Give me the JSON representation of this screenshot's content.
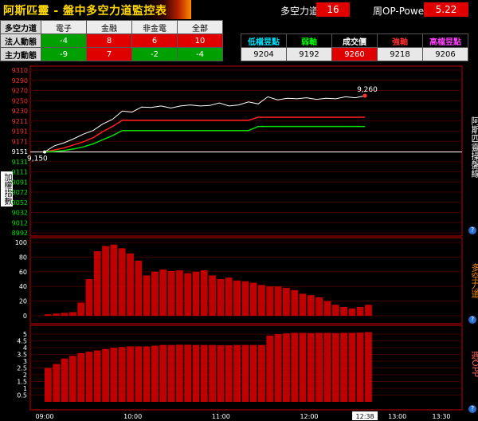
{
  "header": {
    "title": "阿斯匹靈 - 盤中多空力道監控表",
    "power_label": "多空力道",
    "power_value": "16",
    "op_label": "周OP-Power",
    "op_value": "5.22"
  },
  "table1": {
    "corner": "多空力道",
    "columns": [
      "電子",
      "金融",
      "非金電",
      "全部"
    ],
    "rows": [
      {
        "label": "法人動態",
        "cells": [
          {
            "v": "-4",
            "c": "g"
          },
          {
            "v": "8",
            "c": "r"
          },
          {
            "v": "6",
            "c": "r"
          },
          {
            "v": "10",
            "c": "r"
          }
        ]
      },
      {
        "label": "主力動態",
        "cells": [
          {
            "v": "-9",
            "c": "g"
          },
          {
            "v": "7",
            "c": "r"
          },
          {
            "v": "-2",
            "c": "g"
          },
          {
            "v": "-4",
            "c": "g"
          }
        ]
      }
    ]
  },
  "table2": {
    "headers": [
      {
        "label": "低檔昱點",
        "color": "#00e5ff"
      },
      {
        "label": "弱軸",
        "color": "#00ff00"
      },
      {
        "label": "成交價",
        "color": "#ffffff"
      },
      {
        "label": "強軸",
        "color": "#ff3030"
      },
      {
        "label": "高檔昱點",
        "color": "#ff40ff"
      }
    ],
    "values": [
      "9204",
      "9192",
      "9260",
      "9218",
      "9206"
    ],
    "highlight_index": 2
  },
  "side_labels": {
    "left_price": "加權指數",
    "right_top": "阿斯匹靈操盤線",
    "right_mid": "多空力道",
    "right_bot": "週OPP"
  },
  "chart_data": [
    {
      "type": "line",
      "title": "",
      "yticks": [
        "9310",
        "9290",
        "9270",
        "9250",
        "9230",
        "9211",
        "9191",
        "9171",
        "9151",
        "9131",
        "9111",
        "9091",
        "9072",
        "9052",
        "9032",
        "9012",
        "8992"
      ],
      "ylim": [
        8992,
        9310
      ],
      "open_label": "9,150",
      "last_label": "9,260",
      "series": [
        {
          "name": "成交價",
          "color": "#ffffff",
          "values": [
            9150,
            9162,
            9168,
            9176,
            9185,
            9192,
            9205,
            9214,
            9230,
            9228,
            9238,
            9237,
            9240,
            9236,
            9240,
            9242,
            9240,
            9241,
            9246,
            9240,
            9242,
            9248,
            9244,
            9258,
            9252,
            9255,
            9254,
            9256,
            9253,
            9255,
            9254,
            9258,
            9256,
            9260
          ]
        },
        {
          "name": "強軸",
          "color": "#ff2020",
          "values": [
            9150,
            9154,
            9158,
            9164,
            9170,
            9178,
            9190,
            9200,
            9212,
            9212,
            9212,
            9212,
            9212,
            9212,
            9212,
            9212,
            9212,
            9212,
            9212,
            9212,
            9212,
            9212,
            9218,
            9218,
            9218,
            9218,
            9218,
            9218,
            9218,
            9218,
            9218,
            9218,
            9218,
            9218
          ]
        },
        {
          "name": "弱軸",
          "color": "#00e000",
          "values": [
            9150,
            9151,
            9153,
            9156,
            9160,
            9166,
            9174,
            9182,
            9192,
            9192,
            9192,
            9192,
            9192,
            9192,
            9192,
            9192,
            9192,
            9192,
            9192,
            9192,
            9192,
            9192,
            9200,
            9200,
            9200,
            9200,
            9200,
            9200,
            9200,
            9200,
            9200,
            9200,
            9200,
            9200
          ]
        }
      ],
      "open_value": 9150
    },
    {
      "type": "bar",
      "title": "",
      "yticks": [
        "100",
        "80",
        "60",
        "40",
        "20",
        "0"
      ],
      "ylim": [
        0,
        100
      ],
      "values": [
        2,
        3,
        4,
        5,
        18,
        50,
        88,
        95,
        97,
        92,
        85,
        75,
        55,
        60,
        63,
        61,
        62,
        58,
        60,
        62,
        55,
        50,
        52,
        48,
        47,
        45,
        42,
        40,
        40,
        38,
        35,
        30,
        28,
        25,
        20,
        15,
        12,
        10,
        12,
        15
      ]
    },
    {
      "type": "bar",
      "title": "",
      "yticks": [
        "5",
        "4.5",
        "4",
        "3.5",
        "3",
        "2.5",
        "2",
        "1.5",
        "1",
        "0.5"
      ],
      "ylim": [
        0,
        5.3
      ],
      "values": [
        2.5,
        2.8,
        3.2,
        3.4,
        3.6,
        3.7,
        3.8,
        3.9,
        4.0,
        4.05,
        4.1,
        4.1,
        4.1,
        4.15,
        4.2,
        4.2,
        4.22,
        4.22,
        4.2,
        4.2,
        4.2,
        4.18,
        4.18,
        4.2,
        4.2,
        4.2,
        4.2,
        4.9,
        5.0,
        5.05,
        5.1,
        5.1,
        5.08,
        5.1,
        5.1,
        5.08,
        5.1,
        5.1,
        5.12,
        5.15
      ]
    }
  ],
  "time_axis": {
    "labels": [
      "09:00",
      "10:00",
      "11:00",
      "12:00",
      "12:38",
      "13:00",
      "13:30"
    ],
    "current_time": "12:38"
  },
  "colors": {
    "panel_border": "#c00000",
    "grid": "#400000",
    "accent": "#e00000"
  }
}
